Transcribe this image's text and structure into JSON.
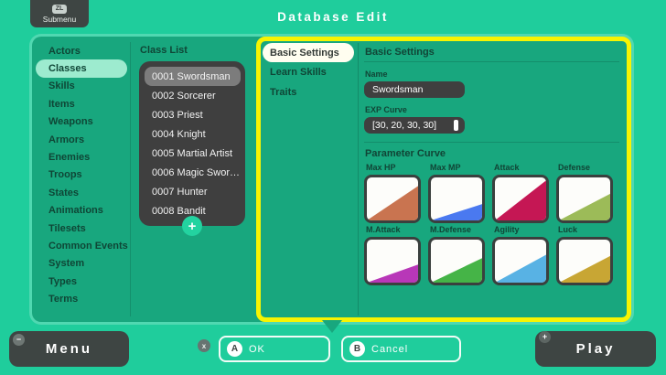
{
  "header": {
    "submenu_key": "ZL",
    "submenu_label": "Submenu",
    "title": "Database Edit"
  },
  "sidebar": {
    "items": [
      "Actors",
      "Classes",
      "Skills",
      "Items",
      "Weapons",
      "Armors",
      "Enemies",
      "Troops",
      "States",
      "Animations",
      "Tilesets",
      "Common Events",
      "System",
      "Types",
      "Terms"
    ],
    "selected": "Classes"
  },
  "class_list": {
    "title": "Class List",
    "items": [
      "0001 Swordsman",
      "0002 Sorcerer",
      "0003 Priest",
      "0004 Knight",
      "0005 Martial Artist",
      "0006 Magic Swor…",
      "0007 Hunter",
      "0008 Bandit"
    ],
    "selected": "0001 Swordsman",
    "add_button": "+"
  },
  "editor": {
    "tabs": [
      "Basic Settings",
      "Learn Skills",
      "Traits"
    ],
    "selected_tab": "Basic Settings",
    "panel_title": "Basic Settings",
    "fields": {
      "name_label": "Name",
      "name_value": "Swordsman",
      "exp_label": "EXP Curve",
      "exp_value": "[30, 20, 30, 30]"
    },
    "parameter_curve": {
      "title": "Parameter Curve",
      "cards": [
        {
          "label": "Max HP",
          "color": "#C97450",
          "right_height": 0.8
        },
        {
          "label": "Max MP",
          "color": "#4A79F0",
          "right_height": 0.38
        },
        {
          "label": "Attack",
          "color": "#C51754",
          "right_height": 0.93
        },
        {
          "label": "Defense",
          "color": "#9CBB58",
          "right_height": 0.62
        },
        {
          "label": "M.Attack",
          "color": "#B837B8",
          "right_height": 0.42
        },
        {
          "label": "M.Defense",
          "color": "#45B447",
          "right_height": 0.57
        },
        {
          "label": "Agility",
          "color": "#58B2E4",
          "right_height": 0.65
        },
        {
          "label": "Luck",
          "color": "#C8A634",
          "right_height": 0.62
        }
      ]
    }
  },
  "footer": {
    "menu": {
      "badge": "−",
      "label": "Menu"
    },
    "x_key": "x",
    "ok": {
      "key": "A",
      "label": "OK"
    },
    "cancel": {
      "key": "B",
      "label": "Cancel"
    },
    "play": {
      "badge": "+",
      "label": "Play"
    }
  },
  "colors": {
    "background": "#1FCD9C",
    "panel": "#18A77E",
    "highlight_border": "#F7F402",
    "selected_pill": "#9DEBCF",
    "dark_button": "#3E4543"
  }
}
